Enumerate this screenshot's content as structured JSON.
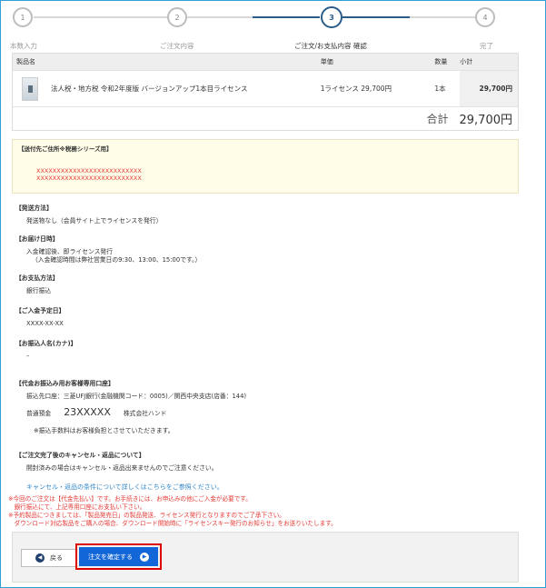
{
  "steps": [
    {
      "num": "1",
      "label": "本数入力"
    },
    {
      "num": "2",
      "label": "ご注文内容"
    },
    {
      "num": "3",
      "label": "ご注文/お支払内容 確認"
    },
    {
      "num": "4",
      "label": "完了"
    }
  ],
  "cart": {
    "headers": {
      "name": "製品名",
      "price": "単価",
      "qty": "数量",
      "subtotal": "小計"
    },
    "item": {
      "name": "法人税・地方税 令和2年度版 バージョンアップ1本目ライセンス",
      "unit_price": "1ライセンス 29,700円",
      "qty": "1本",
      "subtotal": "29,700円"
    },
    "total_label": "合計",
    "total_value": "29,700円"
  },
  "address": {
    "title": "【送付先ご住所※税務シリーズ用】",
    "line1": "XXXXXXXXXXXXXXXXXXXXXXXXXX",
    "line2": "XXXXXXXXXXXXXXXXXXXXXXXXXX"
  },
  "shipping": {
    "title": "【発送方法】",
    "value": "発送物なし（会員サイト上でライセンスを発行）"
  },
  "delivery": {
    "title": "【お届け日時】",
    "line1": "入金確認後、即ライセンス発行",
    "line2": "（入金確認時間は弊社営業日の9:30、13:00、15:00です。）"
  },
  "payment": {
    "title": "【お支払方法】",
    "value": "銀行振込"
  },
  "deposit_date": {
    "title": "【ご入金予定日】",
    "value": "XXXX-XX-XX"
  },
  "transfer_name": {
    "title": "【お振込人名(カナ)】",
    "value": "–"
  },
  "bank": {
    "title": "【代金お振込み用お客様専用口座】",
    "line1": "振込先口座：三菱UFJ銀行(金融機関コード：0005)／関西中央支店(店番：144)",
    "type": "普通預金",
    "number": "23XXXXX",
    "holder": "株式会社ハンド",
    "fee_note": "※振込手数料はお客様負担とさせていただきます。"
  },
  "cancel": {
    "title": "【ご注文完了後のキャンセル・返品について】",
    "value": "開封済みの場合はキャンセル・返品出来ませんのでご注意ください。",
    "link": "キャンセル・返品の条件について詳しくはこちらをご参照ください。"
  },
  "notices": [
    "※今回のご注文は【代金先払い】です。お手続きには、お申込みの他にご入金が必要です。",
    "　銀行振込にて、上記専用口座にお支払い下さい。",
    "※予約製品につきましては、「製品発売日」の製品発送、ライセンス発行となりますのでご了承下さい。",
    "　ダウンロード対応製品をご購入の場合、ダウンロード開始時に「ライセンスキー発行のお知らせ」をお送りいたします。"
  ],
  "buttons": {
    "back": "戻る",
    "confirm": "注文を確定する"
  }
}
